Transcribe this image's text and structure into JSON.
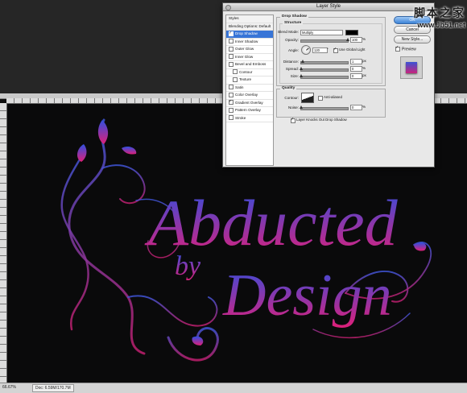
{
  "dialog": {
    "title": "Layer Style",
    "styles": [
      {
        "label": "Styles",
        "checkbox": false,
        "checked": false,
        "selected": false,
        "header": true,
        "sub": false
      },
      {
        "label": "Blending Options: Default",
        "checkbox": false,
        "checked": false,
        "selected": false,
        "header": true,
        "sub": false
      },
      {
        "label": "Drop Shadow",
        "checkbox": true,
        "checked": true,
        "selected": true,
        "header": false,
        "sub": false
      },
      {
        "label": "Inner Shadow",
        "checkbox": true,
        "checked": false,
        "selected": false,
        "header": false,
        "sub": false
      },
      {
        "label": "Outer Glow",
        "checkbox": true,
        "checked": false,
        "selected": false,
        "header": false,
        "sub": false
      },
      {
        "label": "Inner Glow",
        "checkbox": true,
        "checked": false,
        "selected": false,
        "header": false,
        "sub": false
      },
      {
        "label": "Bevel and Emboss",
        "checkbox": true,
        "checked": false,
        "selected": false,
        "header": false,
        "sub": false
      },
      {
        "label": "Contour",
        "checkbox": true,
        "checked": false,
        "selected": false,
        "header": false,
        "sub": true
      },
      {
        "label": "Texture",
        "checkbox": true,
        "checked": false,
        "selected": false,
        "header": false,
        "sub": true
      },
      {
        "label": "Satin",
        "checkbox": true,
        "checked": false,
        "selected": false,
        "header": false,
        "sub": false
      },
      {
        "label": "Color Overlay",
        "checkbox": true,
        "checked": false,
        "selected": false,
        "header": false,
        "sub": false
      },
      {
        "label": "Gradient Overlay",
        "checkbox": true,
        "checked": true,
        "selected": false,
        "header": false,
        "sub": false
      },
      {
        "label": "Pattern Overlay",
        "checkbox": true,
        "checked": false,
        "selected": false,
        "header": false,
        "sub": false
      },
      {
        "label": "Stroke",
        "checkbox": true,
        "checked": false,
        "selected": false,
        "header": false,
        "sub": false
      }
    ],
    "drop_shadow": {
      "section_title": "Drop Shadow",
      "structure_title": "Structure",
      "blend_mode_label": "Blend Mode:",
      "blend_mode_value": "Multiply",
      "shadow_color": "#000000",
      "opacity_label": "Opacity:",
      "opacity_value": "100",
      "opacity_unit": "%",
      "angle_label": "Angle:",
      "angle_value": "120",
      "angle_unit": "°",
      "global_light_label": "Use Global Light",
      "global_light_checked": true,
      "distance_label": "Distance:",
      "distance_value": "1",
      "distance_unit": "px",
      "spread_label": "Spread:",
      "spread_value": "0",
      "spread_unit": "%",
      "size_label": "Size:",
      "size_value": "0",
      "size_unit": "px",
      "quality_title": "Quality",
      "contour_label": "Contour:",
      "anti_aliased_label": "Anti-aliased",
      "noise_label": "Noise:",
      "noise_value": "0",
      "noise_unit": "%",
      "knockout_label": "Layer Knocks Out Drop Shadow",
      "knockout_checked": true
    },
    "buttons": {
      "ok": "OK",
      "cancel": "Cancel",
      "new_style": "New Style...",
      "preview": "Preview"
    }
  },
  "artwork": {
    "line1": "Abducted",
    "line2": "by",
    "line3": "Design",
    "gradient_top": "#2f4fe0",
    "gradient_bottom": "#e01f78"
  },
  "status": {
    "zoom": "66.67%",
    "doc": "Doc: 6.59M/170.7M"
  },
  "watermark": {
    "cn": "脚本之家",
    "url": "www.Jb51.net"
  }
}
